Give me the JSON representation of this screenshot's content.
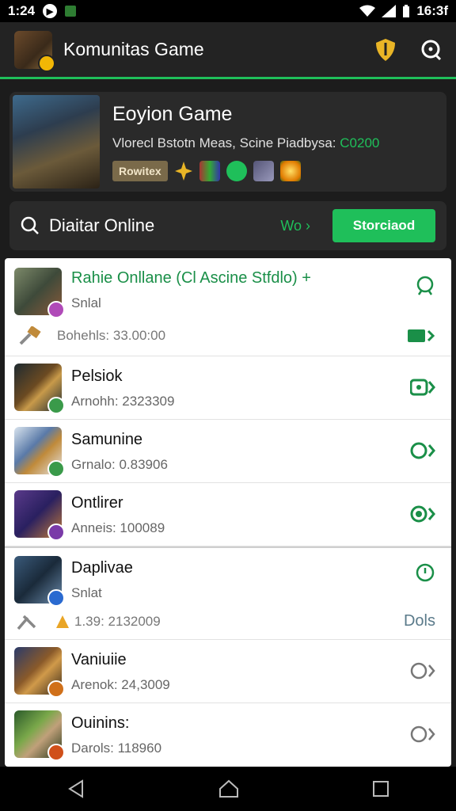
{
  "status_bar": {
    "time_left": "1:24",
    "time_right": "16:3f"
  },
  "app_bar": {
    "title": "Komunitas Game"
  },
  "hero": {
    "title": "Eoyion Game",
    "subtitle": "Vlorecl Bstotn Meas, Scine Piadbysa:",
    "price": "C0200",
    "badge": "Rowitex"
  },
  "search_row": {
    "label": "Diaitar Online",
    "more": "Wo ›",
    "button": "Storciaod"
  },
  "games": [
    {
      "name": "Rahie Onllane (Cl Ascine Stfdlo) +",
      "sub": "Snlal",
      "extra_text": "Bohehls: 33.00:00",
      "highlight": true
    },
    {
      "name": "Pelsiok",
      "sub": "Arnohh: 2323309"
    },
    {
      "name": "Samunine",
      "sub": "Grnalo: 0.83906"
    },
    {
      "name": "Ontlirer",
      "sub": "Anneis: 100089"
    },
    {
      "name": "Daplivae",
      "sub": "Snlat",
      "extra_text": "1.39: 2132009",
      "extra_right": "Dols"
    },
    {
      "name": "Vaniuiie",
      "sub": "Arenok: 24,3009"
    },
    {
      "name": "Ouinins:",
      "sub": "Darols: 118960"
    }
  ],
  "colors": {
    "accent": "#1fbf5a",
    "app_bar": "#232323",
    "card": "#2a2a2a"
  }
}
